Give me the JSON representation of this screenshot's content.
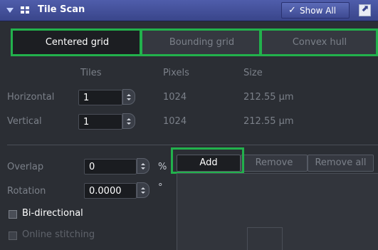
{
  "titlebar": {
    "title": "Tile Scan",
    "show_all_check": "✓",
    "show_all_label": "Show All",
    "detach_glyph": "⬈"
  },
  "tabs": [
    {
      "label": "Centered grid",
      "active": true
    },
    {
      "label": "Bounding grid",
      "active": false
    },
    {
      "label": "Convex hull",
      "active": false
    }
  ],
  "grid": {
    "headers": {
      "tiles": "Tiles",
      "pixels": "Pixels",
      "size": "Size"
    },
    "rows": [
      {
        "label": "Horizontal",
        "tiles": "1",
        "pixels": "1024",
        "size": "212.55 µm"
      },
      {
        "label": "Vertical",
        "tiles": "1",
        "pixels": "1024",
        "size": "212.55 µm"
      }
    ]
  },
  "overlap": {
    "label": "Overlap",
    "value": "0",
    "unit": "%"
  },
  "rotation": {
    "label": "Rotation",
    "value": "0.0000",
    "unit": "°"
  },
  "options": {
    "bidirectional": {
      "label": "Bi-directional",
      "checked": false
    },
    "online_stitching": {
      "label": "Online stitching",
      "checked": false,
      "enabled": false
    }
  },
  "actions": {
    "add": "Add",
    "remove": "Remove",
    "remove_all": "Remove all"
  },
  "colors": {
    "title_bar": "#3f4b95",
    "panel_bg": "#2b2e34",
    "highlight": "#22b14c",
    "active_tab": "#1c1e22"
  }
}
